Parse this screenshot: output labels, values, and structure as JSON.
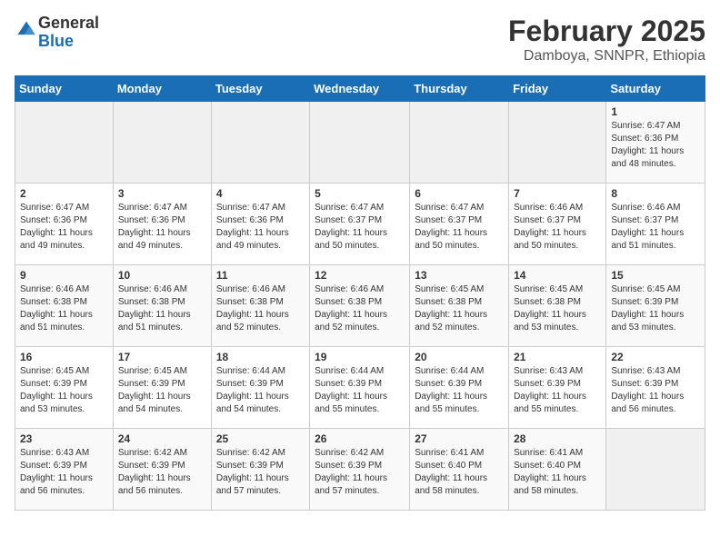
{
  "logo": {
    "general": "General",
    "blue": "Blue"
  },
  "header": {
    "title": "February 2025",
    "subtitle": "Damboya, SNNPR, Ethiopia"
  },
  "weekdays": [
    "Sunday",
    "Monday",
    "Tuesday",
    "Wednesday",
    "Thursday",
    "Friday",
    "Saturday"
  ],
  "weeks": [
    [
      {
        "day": "",
        "info": ""
      },
      {
        "day": "",
        "info": ""
      },
      {
        "day": "",
        "info": ""
      },
      {
        "day": "",
        "info": ""
      },
      {
        "day": "",
        "info": ""
      },
      {
        "day": "",
        "info": ""
      },
      {
        "day": "1",
        "info": "Sunrise: 6:47 AM\nSunset: 6:36 PM\nDaylight: 11 hours and 48 minutes."
      }
    ],
    [
      {
        "day": "2",
        "info": "Sunrise: 6:47 AM\nSunset: 6:36 PM\nDaylight: 11 hours and 49 minutes."
      },
      {
        "day": "3",
        "info": "Sunrise: 6:47 AM\nSunset: 6:36 PM\nDaylight: 11 hours and 49 minutes."
      },
      {
        "day": "4",
        "info": "Sunrise: 6:47 AM\nSunset: 6:36 PM\nDaylight: 11 hours and 49 minutes."
      },
      {
        "day": "5",
        "info": "Sunrise: 6:47 AM\nSunset: 6:37 PM\nDaylight: 11 hours and 50 minutes."
      },
      {
        "day": "6",
        "info": "Sunrise: 6:47 AM\nSunset: 6:37 PM\nDaylight: 11 hours and 50 minutes."
      },
      {
        "day": "7",
        "info": "Sunrise: 6:46 AM\nSunset: 6:37 PM\nDaylight: 11 hours and 50 minutes."
      },
      {
        "day": "8",
        "info": "Sunrise: 6:46 AM\nSunset: 6:37 PM\nDaylight: 11 hours and 51 minutes."
      }
    ],
    [
      {
        "day": "9",
        "info": "Sunrise: 6:46 AM\nSunset: 6:38 PM\nDaylight: 11 hours and 51 minutes."
      },
      {
        "day": "10",
        "info": "Sunrise: 6:46 AM\nSunset: 6:38 PM\nDaylight: 11 hours and 51 minutes."
      },
      {
        "day": "11",
        "info": "Sunrise: 6:46 AM\nSunset: 6:38 PM\nDaylight: 11 hours and 52 minutes."
      },
      {
        "day": "12",
        "info": "Sunrise: 6:46 AM\nSunset: 6:38 PM\nDaylight: 11 hours and 52 minutes."
      },
      {
        "day": "13",
        "info": "Sunrise: 6:45 AM\nSunset: 6:38 PM\nDaylight: 11 hours and 52 minutes."
      },
      {
        "day": "14",
        "info": "Sunrise: 6:45 AM\nSunset: 6:38 PM\nDaylight: 11 hours and 53 minutes."
      },
      {
        "day": "15",
        "info": "Sunrise: 6:45 AM\nSunset: 6:39 PM\nDaylight: 11 hours and 53 minutes."
      }
    ],
    [
      {
        "day": "16",
        "info": "Sunrise: 6:45 AM\nSunset: 6:39 PM\nDaylight: 11 hours and 53 minutes."
      },
      {
        "day": "17",
        "info": "Sunrise: 6:45 AM\nSunset: 6:39 PM\nDaylight: 11 hours and 54 minutes."
      },
      {
        "day": "18",
        "info": "Sunrise: 6:44 AM\nSunset: 6:39 PM\nDaylight: 11 hours and 54 minutes."
      },
      {
        "day": "19",
        "info": "Sunrise: 6:44 AM\nSunset: 6:39 PM\nDaylight: 11 hours and 55 minutes."
      },
      {
        "day": "20",
        "info": "Sunrise: 6:44 AM\nSunset: 6:39 PM\nDaylight: 11 hours and 55 minutes."
      },
      {
        "day": "21",
        "info": "Sunrise: 6:43 AM\nSunset: 6:39 PM\nDaylight: 11 hours and 55 minutes."
      },
      {
        "day": "22",
        "info": "Sunrise: 6:43 AM\nSunset: 6:39 PM\nDaylight: 11 hours and 56 minutes."
      }
    ],
    [
      {
        "day": "23",
        "info": "Sunrise: 6:43 AM\nSunset: 6:39 PM\nDaylight: 11 hours and 56 minutes."
      },
      {
        "day": "24",
        "info": "Sunrise: 6:42 AM\nSunset: 6:39 PM\nDaylight: 11 hours and 56 minutes."
      },
      {
        "day": "25",
        "info": "Sunrise: 6:42 AM\nSunset: 6:39 PM\nDaylight: 11 hours and 57 minutes."
      },
      {
        "day": "26",
        "info": "Sunrise: 6:42 AM\nSunset: 6:39 PM\nDaylight: 11 hours and 57 minutes."
      },
      {
        "day": "27",
        "info": "Sunrise: 6:41 AM\nSunset: 6:40 PM\nDaylight: 11 hours and 58 minutes."
      },
      {
        "day": "28",
        "info": "Sunrise: 6:41 AM\nSunset: 6:40 PM\nDaylight: 11 hours and 58 minutes."
      },
      {
        "day": "",
        "info": ""
      }
    ]
  ]
}
